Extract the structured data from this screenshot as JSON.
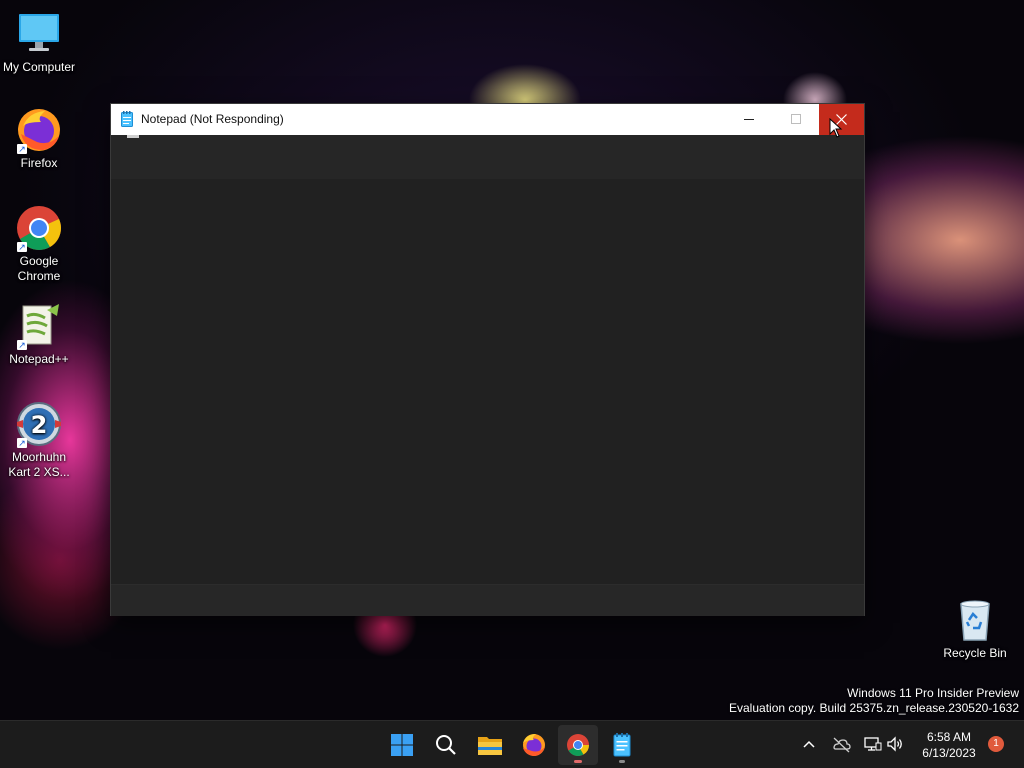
{
  "desktop": {
    "icons": [
      {
        "label": "My Computer",
        "icon": "computer-icon"
      },
      {
        "label": "Firefox",
        "icon": "firefox-icon"
      },
      {
        "label": "Google Chrome",
        "icon": "chrome-icon"
      },
      {
        "label": "Notepad++",
        "icon": "notepadpp-icon"
      },
      {
        "label": "Moorhuhn Kart 2 XS...",
        "icon": "moorhuhn-icon"
      },
      {
        "label": "Recycle Bin",
        "icon": "recycle-bin-icon"
      }
    ],
    "watermark": {
      "line1": "Windows 11 Pro Insider Preview",
      "line2": "Evaluation copy. Build 25375.zn_release.230520-1632"
    }
  },
  "window": {
    "title": "Notepad (Not Responding)",
    "icon": "notepad-icon",
    "close_color": "#c42b1c"
  },
  "taskbar": {
    "apps": [
      {
        "icon": "windows-start-icon",
        "active": false
      },
      {
        "icon": "search-icon",
        "active": false
      },
      {
        "icon": "file-explorer-icon",
        "active": false
      },
      {
        "icon": "firefox-icon",
        "active": false
      },
      {
        "icon": "chrome-icon",
        "active": true
      },
      {
        "icon": "notepad-icon",
        "active": false
      }
    ],
    "tray": {
      "icons": [
        "chevron-up-icon",
        "onedrive-offline-icon",
        "network-icon",
        "volume-icon"
      ],
      "time": "6:58 AM",
      "date": "6/13/2023",
      "notification_count": "1"
    }
  }
}
